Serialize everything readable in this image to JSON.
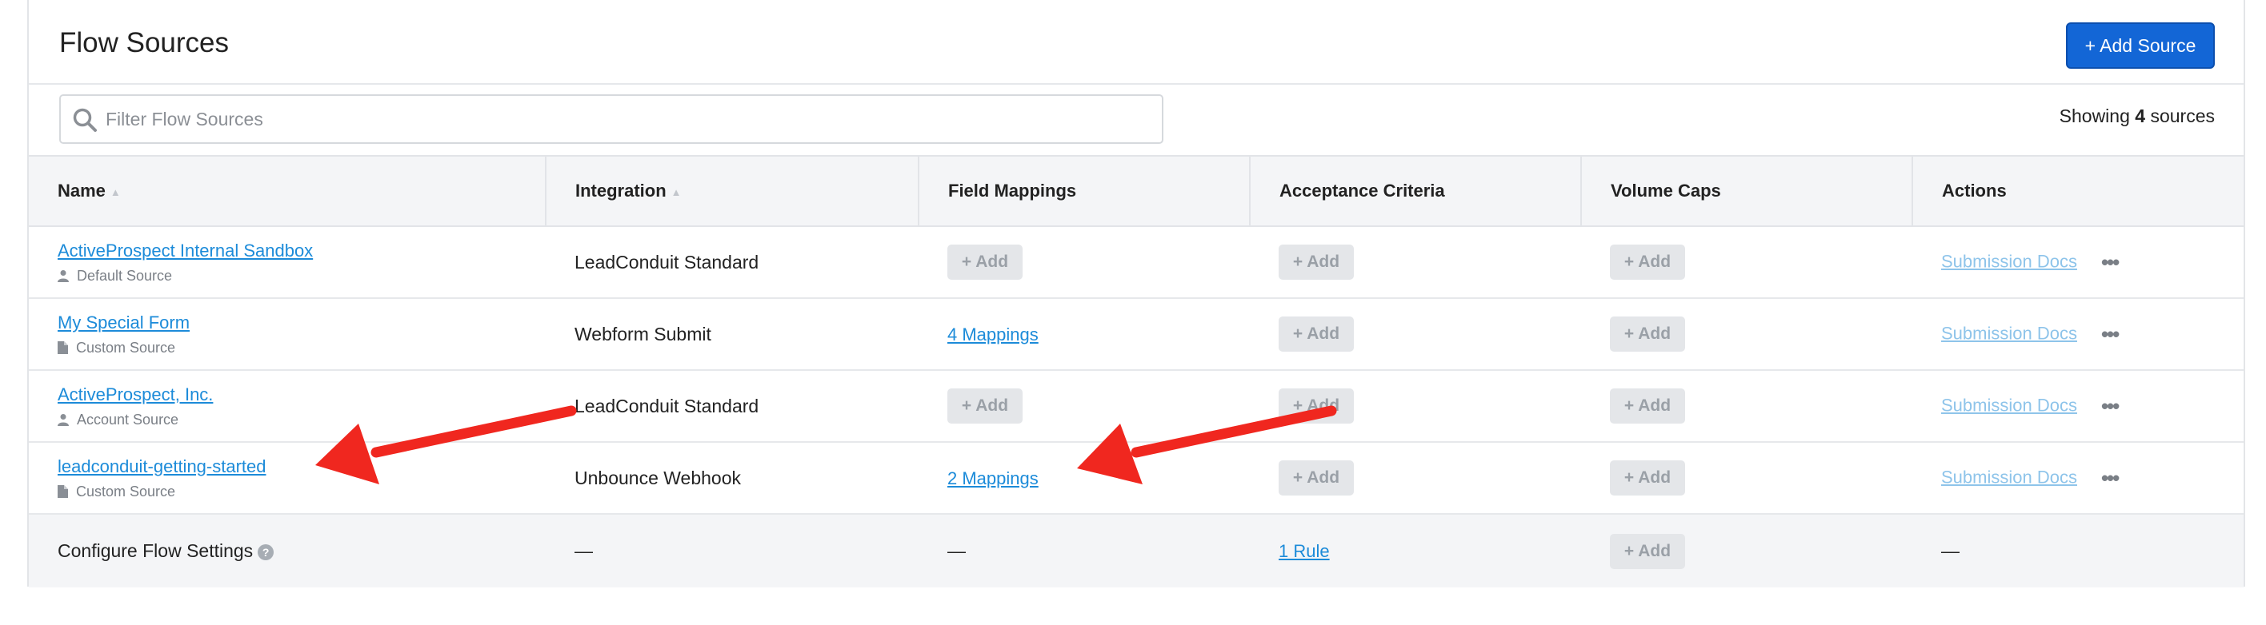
{
  "header": {
    "title": "Flow Sources",
    "add_source_label": "+ Add Source"
  },
  "filter": {
    "placeholder": "Filter Flow Sources",
    "value": ""
  },
  "showing": {
    "prefix": "Showing",
    "count": "4",
    "suffix": "sources"
  },
  "columns": [
    "Name",
    "Integration",
    "Field Mappings",
    "Acceptance Criteria",
    "Volume Caps",
    "Actions"
  ],
  "rows": [
    {
      "name": "ActiveProspect Internal Sandbox",
      "type": "Default Source",
      "type_icon": "user-icon",
      "integration": "LeadConduit Standard",
      "field_mappings": "+ Add",
      "acceptance": "+ Add",
      "volume": "+ Add",
      "action": "Submission Docs"
    },
    {
      "name": "My Special Form",
      "type": "Custom Source",
      "type_icon": "document-icon",
      "integration": "Webform Submit",
      "field_mappings": "4 Mappings",
      "acceptance": "+ Add",
      "volume": "+ Add",
      "action": "Submission Docs"
    },
    {
      "name": "ActiveProspect, Inc.",
      "type": "Account Source",
      "type_icon": "user-icon",
      "integration": "LeadConduit Standard",
      "field_mappings": "+ Add",
      "acceptance": "+ Add",
      "volume": "+ Add",
      "action": "Submission Docs"
    },
    {
      "name": "leadconduit-getting-started",
      "type": "Custom Source",
      "type_icon": "document-icon",
      "integration": "Unbounce Webhook",
      "field_mappings": "2 Mappings",
      "acceptance": "+ Add",
      "volume": "+ Add",
      "action": "Submission Docs"
    }
  ],
  "footer": {
    "name": "Configure Flow Settings",
    "help_icon": "?",
    "integration": "—",
    "field_mappings": "—",
    "acceptance": "1 Rule",
    "volume": "+ Add",
    "actions": "—"
  },
  "colors": {
    "accent": "#1366d6",
    "link": "#1c8bd9",
    "annotation_arrow": "#f0271f"
  }
}
